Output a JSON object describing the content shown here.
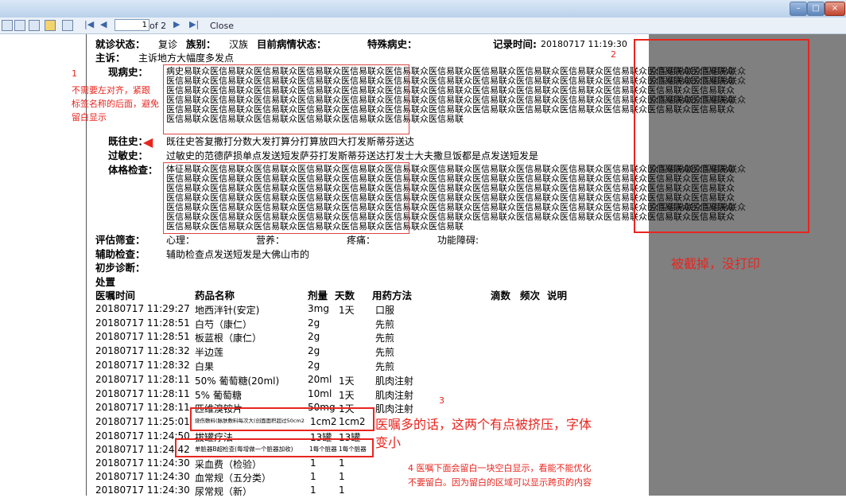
{
  "window": {
    "min_label": "–",
    "max_label": "□",
    "close_label": "×"
  },
  "toolbar": {
    "page_current": "1",
    "page_of": "of 2",
    "close_label": "Close"
  },
  "record": {
    "visit_status_label": "就诊状态：",
    "visit_status_value": "复诊",
    "ethnicity_label": "族别：",
    "ethnicity_value": "汉族",
    "condition_label": "目前病情状态：",
    "special_history_label": "特殊病史：",
    "record_time_label": "记录时间:",
    "record_time_value": "20180717 11:19:30",
    "complaint_label": "主诉：",
    "complaint_value": "主诉地方大幅度多发点",
    "present_history_label": "现病史：",
    "present_history_lines": [
      "病史易联众医信易联众医信易联众医信易联众医信易联众医信易联众医信易联众医信易联众医信易联众医信易联众医信易联众医信易联众医信易联众",
      "医信易联众医信易联众医信易联众医信易联众医信易联众医信易联众医信易联众医信易联众医信易联众医信易联众医信易联众医信易联众医信易联众",
      "医信易联众医信易联众医信易联众医信易联众医信易联众医信易联众医信易联众医信易联众医信易联众医信易联众医信易联众医信易联众医信易联众",
      "医信易联众医信易联众医信易联众医信易联众医信易联众医信易联众医信易联众医信易联众医信易联众医信易联众医信易联众医信易联众医信易联众",
      "医信易联众医信易联众医信易联众医信易联众医信易联众医信易联众医信易联众医信易联众医信易联众医信易联众医信易联众医信易联众医信易联众",
      "医信易联众医信易联众医信易联众医信易联众医信易联众医信易联众医信易联"
    ],
    "past_history_label": "既往史：",
    "past_history_value": "既往史答复撒打分数大发打算分打算放四大打发斯蒂芬送达",
    "allergy_label": "过敏史：",
    "allergy_value": "过敏史的范德萨损单点发送短发萨芬打发斯蒂芬送达打发士大夫撒旦饭都是点发送短发是",
    "physical_label": "体格检查：",
    "physical_lines": [
      "体征易联众医信易联众医信易联众医信易联众医信易联众医信易联众医信易联众医信易联众医信易联众医信易联众医信易联众医信易联众医信易联众",
      "医信易联众医信易联众医信易联众医信易联众医信易联众医信易联众医信易联众医信易联众医信易联众医信易联众医信易联众医信易联众医信易联众",
      "医信易联众医信易联众医信易联众医信易联众医信易联众医信易联众医信易联众医信易联众医信易联众医信易联众医信易联众医信易联众医信易联众",
      "医信易联众医信易联众医信易联众医信易联众医信易联众医信易联众医信易联众医信易联众医信易联众医信易联众医信易联众医信易联众医信易联众",
      "医信易联众医信易联众医信易联众医信易联众医信易联众医信易联众医信易联众医信易联众医信易联众医信易联众医信易联众医信易联众医信易联众",
      "医信易联众医信易联众医信易联众医信易联众医信易联众医信易联众医信易联众医信易联众医信易联众医信易联众医信易联众医信易联众医信易联众",
      "医信易联众医信易联众医信易联众医信易联众医信易联众医信易联众医信易联"
    ],
    "assessment_label": "评估筛查：",
    "mental_label": "心理：",
    "nutrition_label": "营养：",
    "pain_label": "疼痛：",
    "function_label": "功能障碍:",
    "aux_label": "辅助检查：",
    "aux_value": "辅助检查点发送短发是大佛山市的",
    "diagnosis_label": "初步诊断：",
    "treatment_label": "处置"
  },
  "orders": {
    "headers": {
      "time": "医嘱时间",
      "drug": "药品名称",
      "dose": "剂量",
      "days": "天数",
      "usage": "用药方法",
      "drip": "滴数",
      "freq": "频次",
      "note": "说明"
    },
    "rows": [
      {
        "time": "20180717 11:29:27",
        "drug": "地西泮针(安定)",
        "dose": "3mg",
        "days": "1天",
        "usage": "口服"
      },
      {
        "time": "20180717 11:28:51",
        "drug": "白芍（康仁）",
        "dose": "2g",
        "days": "",
        "usage": "先煎"
      },
      {
        "time": "20180717 11:28:51",
        "drug": "板蓝根（康仁）",
        "dose": "2g",
        "days": "",
        "usage": "先煎"
      },
      {
        "time": "20180717 11:28:32",
        "drug": "半边莲",
        "dose": "2g",
        "days": "",
        "usage": "先煎"
      },
      {
        "time": "20180717 11:28:32",
        "drug": "白果",
        "dose": "2g",
        "days": "",
        "usage": "先煎"
      },
      {
        "time": "20180717 11:28:11",
        "drug": "50% 葡萄糖(20ml)",
        "dose": "20ml",
        "days": "1天",
        "usage": "肌肉注射"
      },
      {
        "time": "20180717 11:28:11",
        "drug": "5% 葡萄糖",
        "dose": "10ml",
        "days": "1天",
        "usage": "肌肉注射"
      },
      {
        "time": "20180717 11:28:11",
        "drug": "匹维溴铵片",
        "dose": "50mg",
        "days": "1天",
        "usage": "肌肉注射"
      },
      {
        "time": "20180717 11:25:01",
        "drug": "烧伤敷料(脉肤敷料每次大(创面面积超过50cm2",
        "dose": "1cm2",
        "days": "1cm2",
        "usage": ""
      },
      {
        "time": "20180717 11:24:50",
        "drug": "拔罐疗法",
        "dose": "13罐",
        "days": "13罐",
        "usage": ""
      },
      {
        "time": "20180717 11:24:42",
        "drug": "单脏器B超检查(每增做一个脏器加收)",
        "dose": "1每个脏器",
        "days": "1每个脏器",
        "usage": ""
      },
      {
        "time": "20180717 11:24:30",
        "drug": "采血费（检验）",
        "dose": "1",
        "days": "1",
        "usage": ""
      },
      {
        "time": "20180717 11:24:30",
        "drug": "血常规（五分类）",
        "dose": "1",
        "days": "1",
        "usage": ""
      },
      {
        "time": "20180717 11:24:30",
        "drug": "尿常规（新）",
        "dose": "1",
        "days": "1",
        "usage": ""
      }
    ]
  },
  "annotations": {
    "n1": "1",
    "n1_text_lines": [
      "不需要左对齐，紧跟",
      "标签名称的后面，避免",
      "留白显示"
    ],
    "n2": "2",
    "n2_text": "被截掉，没打印",
    "n3": "3",
    "n3_text_lines": [
      "医嘱多的话，这两个有点被挤压，字体",
      "变小"
    ],
    "n4_text_lines": [
      "4  医嘱下面会留白一块空白显示，看能不能优化",
      "不要留白。因为留白的区域可以显示跨页的内容"
    ]
  },
  "overflow_lines": [
    "众医信易联众医信易联众",
    "众医信易联众医信易联众",
    "众医信易联众医信易联众",
    "众医信易联众医信易联众",
    "众医信易联众医信易联众"
  ],
  "colors": {
    "annotation": "#e8251f",
    "offpage": "#808080"
  }
}
